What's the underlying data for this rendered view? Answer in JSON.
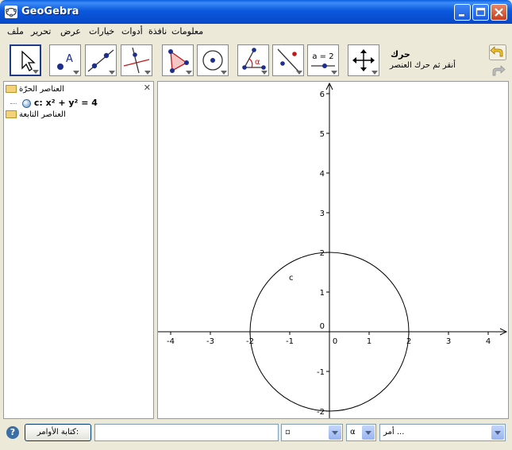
{
  "window": {
    "title": "GeoGebra"
  },
  "menu": [
    "معلومات",
    "نافذة",
    "أدوات",
    "خيارات",
    "عرض",
    "تحرير",
    "ملف"
  ],
  "toolbar": {
    "help_title": "حرك",
    "help_text": "أنقر ثم حرك العنصر",
    "tool_slider_label": "a = 2",
    "tool_angle_label": "α"
  },
  "algebra": {
    "close_glyph": "✕",
    "free_objects": "العناصر الحرّة",
    "dependent_objects": "العناصر التابعة",
    "object": "c: x² + y² = 4"
  },
  "graphics": {
    "circle_label": "c",
    "x_ticks": [
      "-4",
      "-3",
      "-2",
      "-1",
      "0",
      "1",
      "2",
      "3",
      "4"
    ],
    "y_ticks": [
      "6",
      "5",
      "4",
      "3",
      "2",
      "1",
      "0",
      "-1",
      "-2"
    ]
  },
  "bottom": {
    "help": "?",
    "input_button": "كتابة الأوامر:",
    "input_value": "",
    "combo_symbols": "▫",
    "combo_greek": "α",
    "combo_commands": "أمر ..."
  },
  "colors": {
    "title_blue": "#0A5FE0",
    "point_blue": "#1E2E8C",
    "accent_red": "#C01818"
  }
}
